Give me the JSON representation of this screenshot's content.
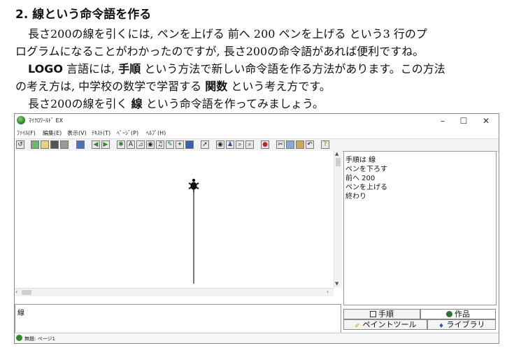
{
  "doc": {
    "heading": "2. 線という命令語を作る",
    "p1_line1": "長さ200の線を引くには, ペンを上げる  前へ   200   ペンを上げる という3 行のプ",
    "p1_line2": "ログラムになることがわかったのですが, 長さ200の命令語があれば便利ですね。",
    "p2_logo": "LOGO",
    "p2_a": " 言語には, ",
    "p2_bold": "手順",
    "p2_b": " という方法で新しい命令語を作る方法があります。この方法",
    "p2_line2_a": "の考え方は, 中学校の数学で学習する ",
    "p2_line2_bold": "関数",
    "p2_line2_b": " という考え方です。",
    "p3_a": "長さ200の線を引く ",
    "p3_bold": "線",
    "p3_b": " という命令語を作ってみましょう。"
  },
  "window": {
    "title": "ﾏｲｸﾛﾜｰﾙﾄﾞ EX",
    "minimize": "–",
    "maximize": "☐",
    "close": "✕"
  },
  "menu": [
    "ﾌｧｲﾙ(F)",
    "編集(E)",
    "表示(V)",
    "ﾃｷｽﾄ(T)",
    "ﾍﾟｰｼﾞ(P)",
    "ﾍﾙﾌﾟ(H)"
  ],
  "procedure_lines": [
    "手順は 線",
    "ペンを下ろす",
    "前へ 200",
    "ペンを上げる",
    "終わり"
  ],
  "command_input": "線",
  "tabs": {
    "procedure": "手順",
    "works": "作品",
    "paint_tool": "ペイントツール",
    "library": "ライブラリ"
  },
  "status": "無題: ページ1",
  "turtle_line": {
    "length": 200
  }
}
